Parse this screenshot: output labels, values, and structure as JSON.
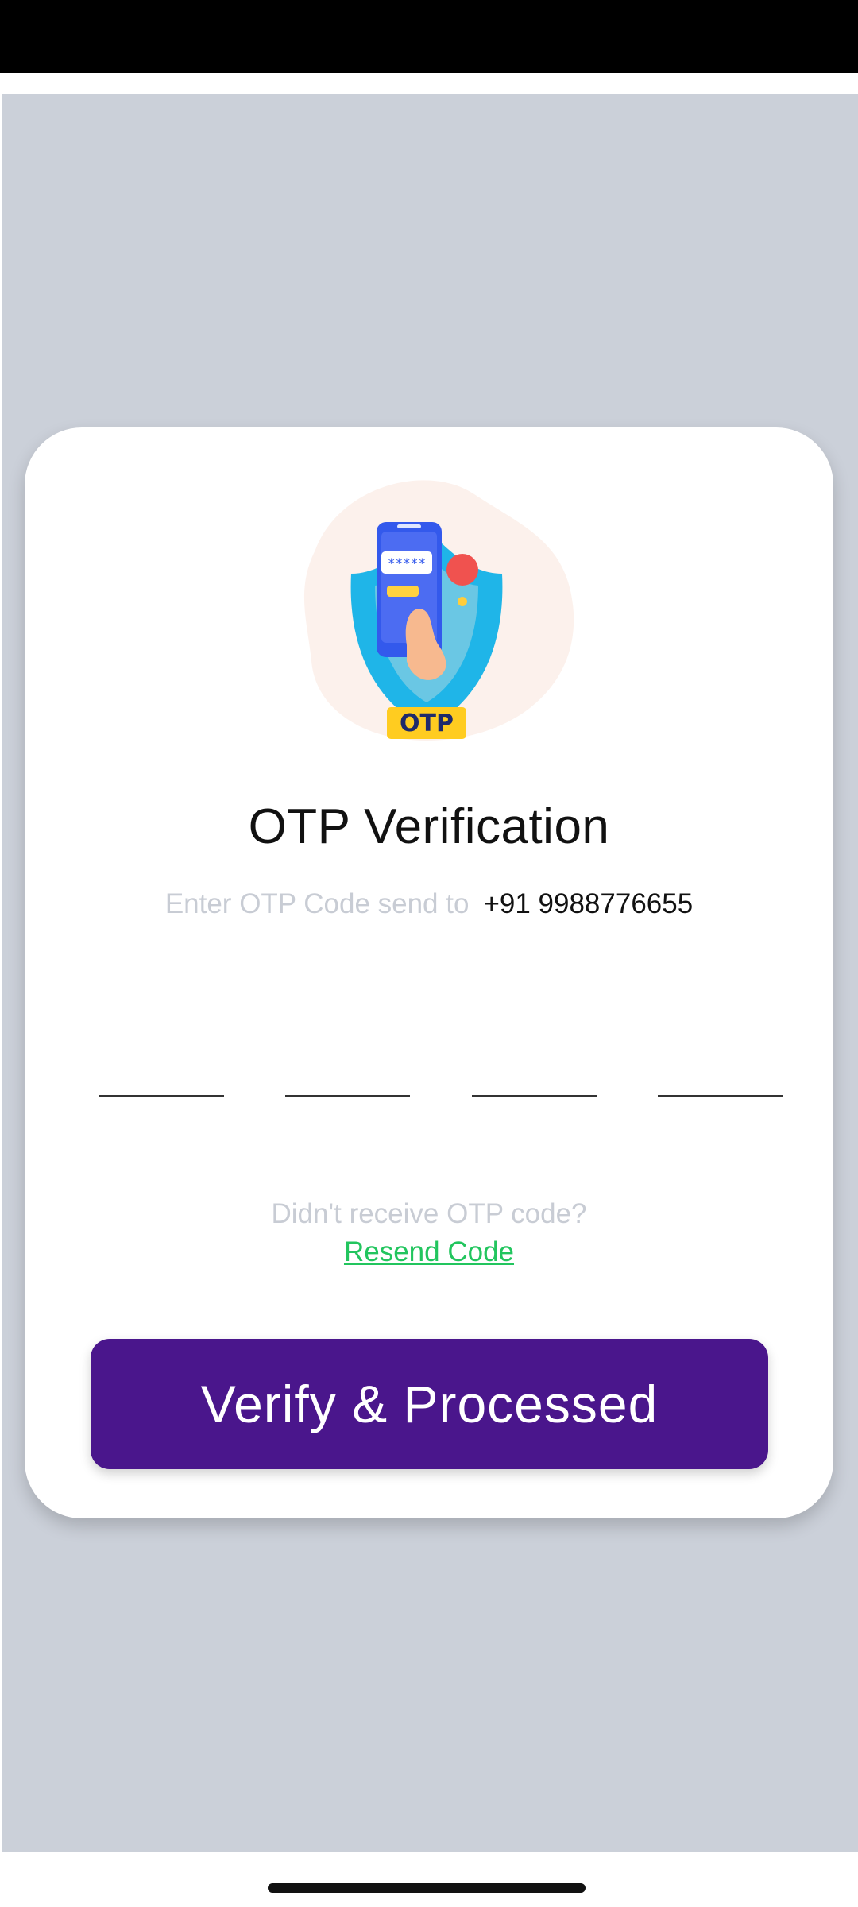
{
  "colors": {
    "status_bar": "#000000",
    "background": "#cbd0d9",
    "card": "#ffffff",
    "primary_button": "#4a168c",
    "link": "#22c55e",
    "muted_text": "#c8ccd4"
  },
  "illustration": {
    "icon": "otp-shield-phone-icon",
    "label": "OTP",
    "masked_code": "*****"
  },
  "title": "OTP Verification",
  "subtitle": {
    "prefix": "Enter OTP Code send to",
    "phone": "+91 9988776655"
  },
  "otp_inputs": [
    "",
    "",
    "",
    ""
  ],
  "resend": {
    "question": "Didn't receive OTP code?",
    "link_label": "Resend Code"
  },
  "verify_button_label": "Verify & Processed"
}
